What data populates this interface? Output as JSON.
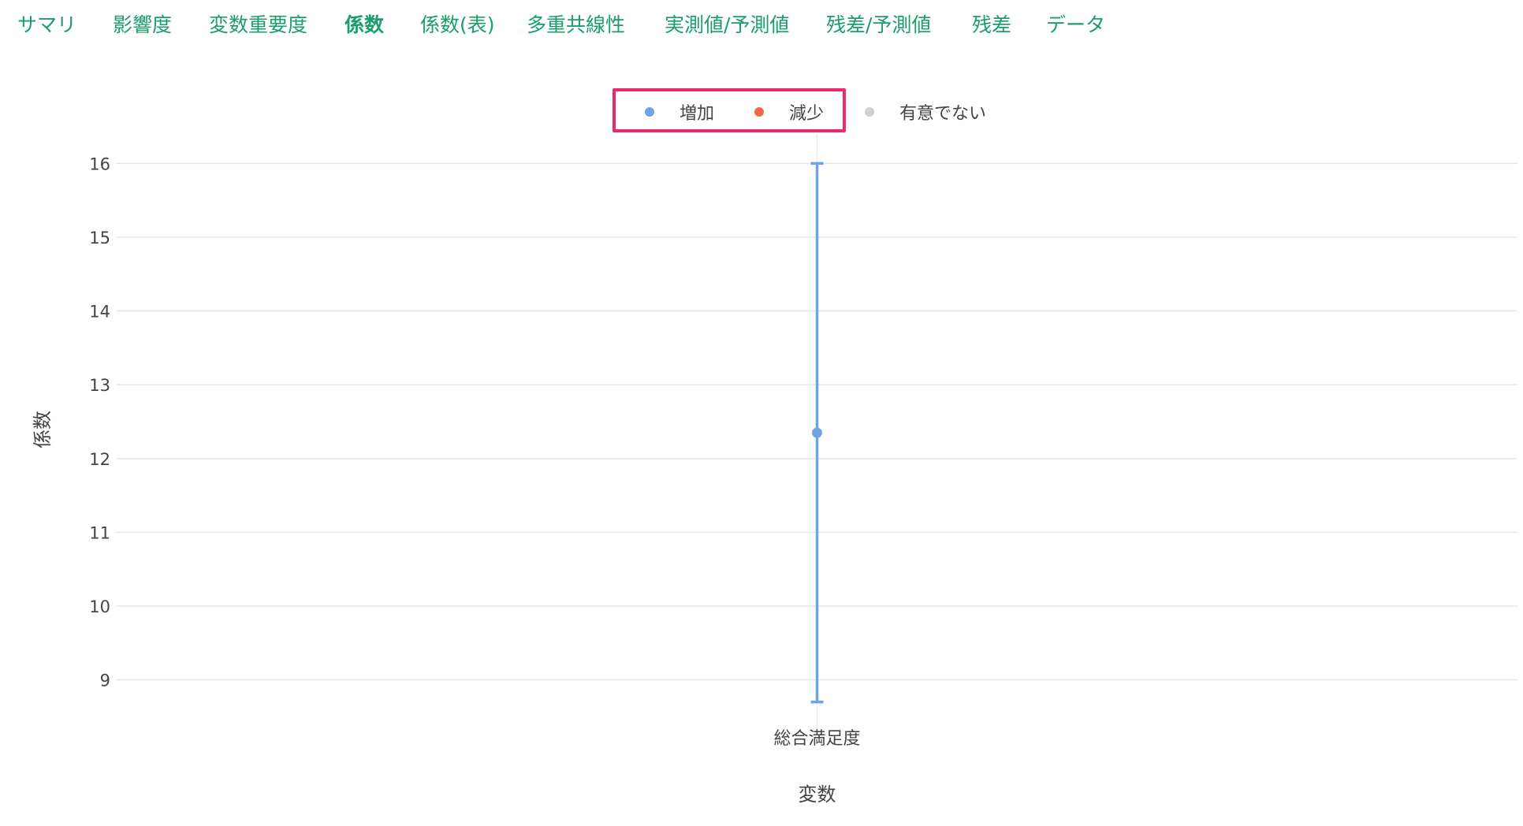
{
  "tabs": [
    {
      "label": "サマリ",
      "active": false
    },
    {
      "label": "影響度",
      "active": false
    },
    {
      "label": "変数重要度",
      "active": false
    },
    {
      "label": "係数",
      "active": true
    },
    {
      "label": "係数(表)",
      "active": false
    },
    {
      "label": "多重共線性",
      "active": false
    },
    {
      "label": "実測値/予測値",
      "active": false
    },
    {
      "label": "残差/予測値",
      "active": false
    },
    {
      "label": "残差",
      "active": false
    },
    {
      "label": "データ",
      "active": false
    }
  ],
  "legend": [
    {
      "label": "増加",
      "color": "#6fa3e6"
    },
    {
      "label": "減少",
      "color": "#ec6a4a"
    },
    {
      "label": "有意でない",
      "color": "#d0d0d0"
    }
  ],
  "legend_highlight_color": "#ec2a6b",
  "chart_data": {
    "type": "scatter",
    "title": "",
    "xlabel": "変数",
    "ylabel": "係数",
    "ylim": [
      8.6,
      16.1
    ],
    "yticks": [
      9,
      10,
      11,
      12,
      13,
      14,
      15,
      16
    ],
    "categories": [
      "総合満足度"
    ],
    "points": [
      {
        "category": "総合満足度",
        "value": 12.35,
        "lower": 8.7,
        "upper": 16.0,
        "group": "増加"
      }
    ],
    "grid": true,
    "legend_position": "top-center"
  }
}
